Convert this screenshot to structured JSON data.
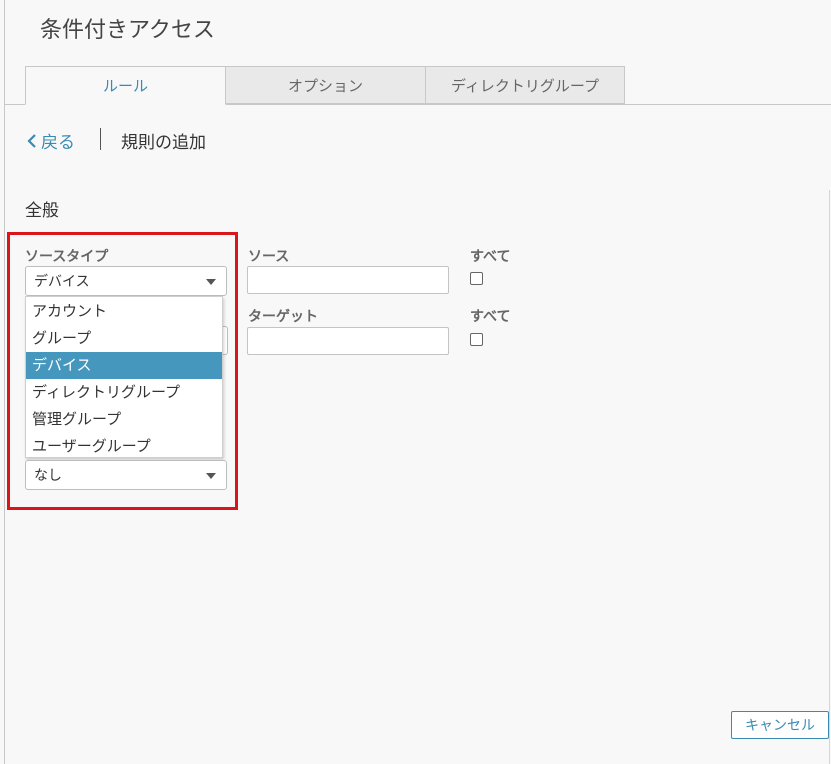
{
  "page": {
    "title": "条件付きアクセス"
  },
  "tabs": [
    {
      "label": "ルール",
      "active": true
    },
    {
      "label": "オプション",
      "active": false
    },
    {
      "label": "ディレクトリグループ",
      "active": false
    }
  ],
  "breadcrumb": {
    "back_label": "戻る",
    "current": "規則の追加"
  },
  "section": {
    "title": "全般"
  },
  "form": {
    "source_type_label": "ソースタイプ",
    "source_type_value": "デバイス",
    "source_label": "ソース",
    "source_all_label": "すべて",
    "target_label": "ターゲット",
    "target_all_label": "すべて",
    "target_type_value": "なし"
  },
  "dropdown": {
    "options": [
      "アカウント",
      "グループ",
      "デバイス",
      "ディレクトリグループ",
      "管理グループ",
      "ユーザーグループ"
    ],
    "selected": "デバイス"
  },
  "footer": {
    "cancel_label": "キャンセル"
  },
  "colors": {
    "accent": "#3a8bb2",
    "selected_bg": "#4697bd",
    "highlight": "#d9161a"
  },
  "icons": {
    "back": "chevron-left-icon",
    "select_caret": "caret-down-icon"
  }
}
